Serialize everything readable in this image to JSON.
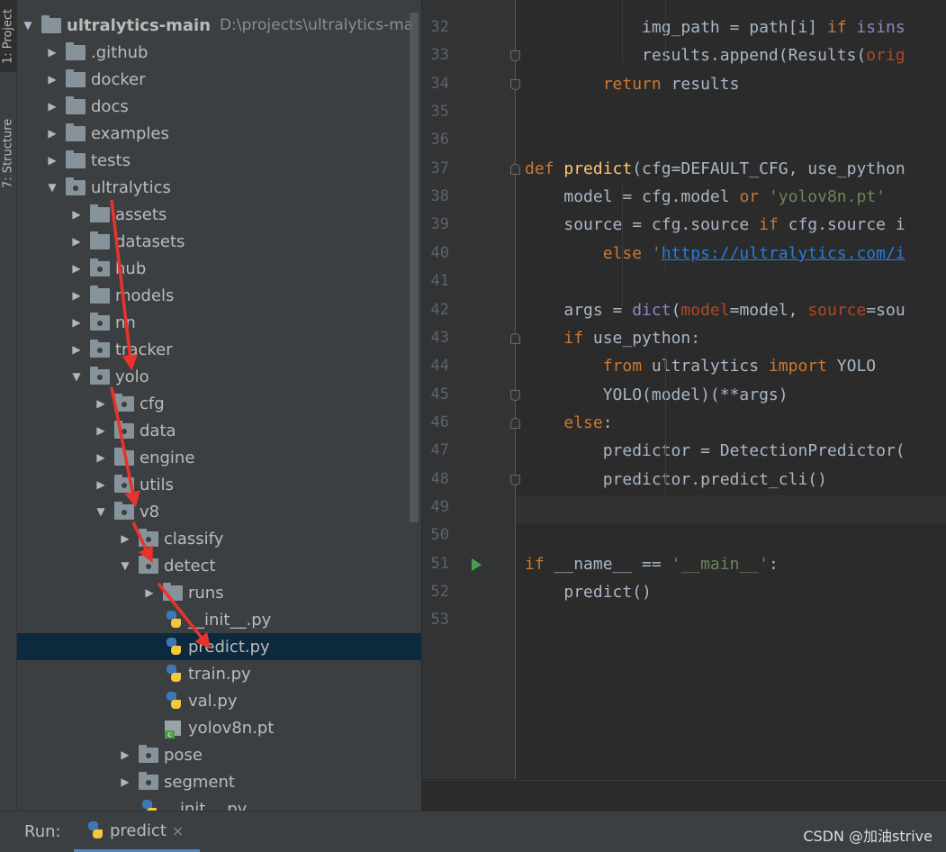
{
  "sidebar_tabs": {
    "project": "1: Project",
    "structure": "7: Structure"
  },
  "project_tree": [
    {
      "name": "ultralytics-main",
      "path": "D:\\projects\\ultralytics-ma",
      "type": "folder",
      "expanded": true,
      "bold": true
    },
    {
      "name": ".github",
      "type": "folder",
      "expanded": false
    },
    {
      "name": "docker",
      "type": "folder",
      "expanded": false
    },
    {
      "name": "docs",
      "type": "folder",
      "expanded": false
    },
    {
      "name": "examples",
      "type": "folder",
      "expanded": false
    },
    {
      "name": "tests",
      "type": "folder",
      "expanded": false
    },
    {
      "name": "ultralytics",
      "type": "package",
      "expanded": true
    },
    {
      "name": "assets",
      "type": "folder",
      "expanded": false
    },
    {
      "name": "datasets",
      "type": "folder",
      "expanded": false
    },
    {
      "name": "hub",
      "type": "package",
      "expanded": false
    },
    {
      "name": "models",
      "type": "folder",
      "expanded": false
    },
    {
      "name": "nn",
      "type": "package",
      "expanded": false
    },
    {
      "name": "tracker",
      "type": "package",
      "expanded": false
    },
    {
      "name": "yolo",
      "type": "package",
      "expanded": true
    },
    {
      "name": "cfg",
      "type": "package",
      "expanded": false
    },
    {
      "name": "data",
      "type": "package",
      "expanded": false
    },
    {
      "name": "engine",
      "type": "folder",
      "expanded": false
    },
    {
      "name": "utils",
      "type": "package",
      "expanded": false
    },
    {
      "name": "v8",
      "type": "package",
      "expanded": true
    },
    {
      "name": "classify",
      "type": "package",
      "expanded": false
    },
    {
      "name": "detect",
      "type": "package",
      "expanded": true
    },
    {
      "name": "runs",
      "type": "folder",
      "expanded": false
    },
    {
      "name": "__init__.py",
      "type": "py"
    },
    {
      "name": "predict.py",
      "type": "py",
      "selected": true
    },
    {
      "name": "train.py",
      "type": "py"
    },
    {
      "name": "val.py",
      "type": "py"
    },
    {
      "name": "yolov8n.pt",
      "type": "pt"
    },
    {
      "name": "pose",
      "type": "package",
      "expanded": false
    },
    {
      "name": "segment",
      "type": "package",
      "expanded": false
    },
    {
      "name": "__init__.py",
      "type": "py"
    }
  ],
  "editor": {
    "line_numbers": [
      "32",
      "33",
      "34",
      "35",
      "36",
      "37",
      "38",
      "39",
      "40",
      "41",
      "42",
      "43",
      "44",
      "45",
      "46",
      "47",
      "48",
      "49",
      "50",
      "51",
      "52",
      "53"
    ],
    "lines": [
      {
        "n": "32",
        "indent": "            ",
        "tokens": [
          [
            "plain",
            "img_path = path[i] "
          ],
          [
            "kw",
            "if "
          ],
          [
            "builtin",
            "isins"
          ]
        ]
      },
      {
        "n": "33",
        "indent": "            ",
        "tokens": [
          [
            "plain",
            "results.append(Results("
          ],
          [
            "param",
            "orig"
          ]
        ]
      },
      {
        "n": "34",
        "indent": "        ",
        "tokens": [
          [
            "kw",
            "return "
          ],
          [
            "plain",
            "results"
          ]
        ]
      },
      {
        "n": "35",
        "indent": "",
        "tokens": []
      },
      {
        "n": "36",
        "indent": "",
        "tokens": []
      },
      {
        "n": "37",
        "indent": "",
        "tokens": [
          [
            "kw",
            "def "
          ],
          [
            "fn",
            "predict"
          ],
          [
            "plain",
            "(cfg=DEFAULT_CFG, use_python"
          ]
        ]
      },
      {
        "n": "38",
        "indent": "    ",
        "tokens": [
          [
            "plain",
            "model = cfg.model "
          ],
          [
            "kw",
            "or "
          ],
          [
            "str",
            "'yolov8n.pt'"
          ]
        ]
      },
      {
        "n": "39",
        "indent": "    ",
        "tokens": [
          [
            "plain",
            "source = cfg.source "
          ],
          [
            "kw",
            "if "
          ],
          [
            "plain",
            "cfg.source i"
          ]
        ]
      },
      {
        "n": "40",
        "indent": "        ",
        "tokens": [
          [
            "kw",
            "else "
          ],
          [
            "str",
            "'"
          ],
          [
            "lnk",
            "https://ultralytics.com/i"
          ]
        ]
      },
      {
        "n": "41",
        "indent": "",
        "tokens": []
      },
      {
        "n": "42",
        "indent": "    ",
        "tokens": [
          [
            "plain",
            "args = "
          ],
          [
            "builtin",
            "dict"
          ],
          [
            "plain",
            "("
          ],
          [
            "param",
            "model"
          ],
          [
            "plain",
            "=model, "
          ],
          [
            "param",
            "source"
          ],
          [
            "plain",
            "=sou"
          ]
        ]
      },
      {
        "n": "43",
        "indent": "    ",
        "tokens": [
          [
            "kw",
            "if "
          ],
          [
            "plain",
            "use_python:"
          ]
        ]
      },
      {
        "n": "44",
        "indent": "        ",
        "tokens": [
          [
            "kw",
            "from "
          ],
          [
            "plain",
            "ultralytics "
          ],
          [
            "kw",
            "import "
          ],
          [
            "plain",
            "YOLO"
          ]
        ]
      },
      {
        "n": "45",
        "indent": "        ",
        "tokens": [
          [
            "plain",
            "YOLO(model)(**args)"
          ]
        ]
      },
      {
        "n": "46",
        "indent": "    ",
        "tokens": [
          [
            "kw",
            "else"
          ],
          [
            "plain",
            ":"
          ]
        ]
      },
      {
        "n": "47",
        "indent": "        ",
        "tokens": [
          [
            "plain",
            "predictor = DetectionPredictor("
          ]
        ]
      },
      {
        "n": "48",
        "indent": "        ",
        "tokens": [
          [
            "plain",
            "predictor.predict_cli()"
          ]
        ]
      },
      {
        "n": "49",
        "indent": "",
        "tokens": []
      },
      {
        "n": "50",
        "indent": "",
        "tokens": []
      },
      {
        "n": "51",
        "indent": "",
        "tokens": [
          [
            "kw",
            "if "
          ],
          [
            "plain",
            "__name__ == "
          ],
          [
            "str",
            "'__main__'"
          ],
          [
            "plain",
            ":"
          ]
        ]
      },
      {
        "n": "52",
        "indent": "    ",
        "tokens": [
          [
            "plain",
            "predict()"
          ]
        ]
      },
      {
        "n": "53",
        "indent": "",
        "tokens": []
      }
    ]
  },
  "run_bar": {
    "label": "Run:",
    "tab": "predict",
    "close": "×"
  },
  "watermark": "CSDN @加油strive",
  "colors": {
    "annotation_arrow": "#e8332b",
    "selection": "#0d293e",
    "keyword": "#cc7832",
    "string": "#6a8759",
    "function": "#ffc66d"
  }
}
